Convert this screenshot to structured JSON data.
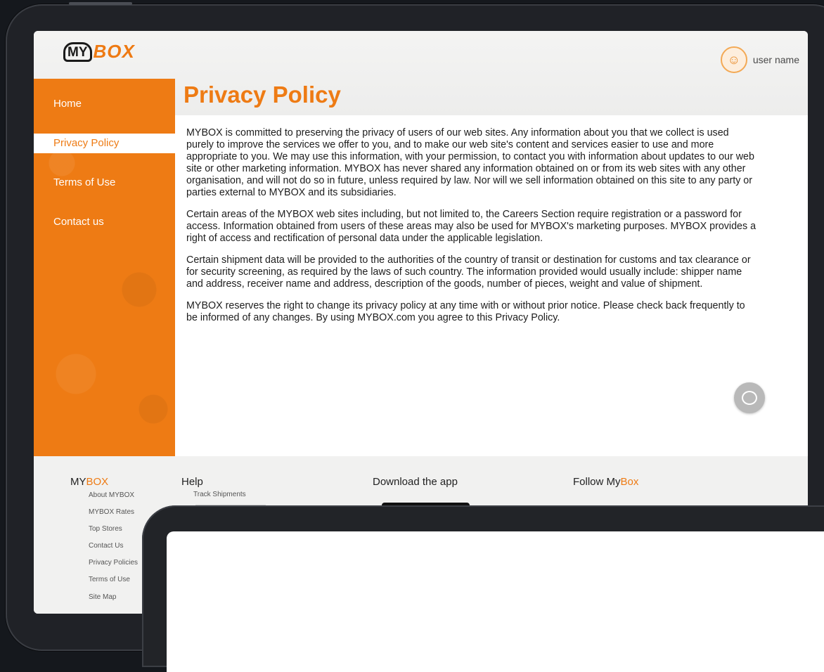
{
  "brand": {
    "logo_my": "MY",
    "logo_box": "BOX"
  },
  "user": {
    "name": "user name",
    "avatar_glyph": "☺"
  },
  "sidebar": {
    "items": [
      {
        "label": "Home",
        "active": false
      },
      {
        "label": "Privacy Policy",
        "active": true
      },
      {
        "label": "Terms of Use",
        "active": false
      },
      {
        "label": "Contact us",
        "active": false
      }
    ]
  },
  "page": {
    "title": "Privacy Policy",
    "paragraphs": [
      "MYBOX is committed to preserving the privacy of users of our web sites. Any information about you that we collect is used purely to improve the services we offer to you, and to make our web site's content and services easier to use and more appropriate to you. We may use this information, with your permission, to contact you with information about updates to our web site or other marketing information. MYBOX has never shared any information obtained on or from its web sites with any other organisation, and will not do so in future, unless required by law. Nor will we sell information obtained on this site to any party or parties external to MYBOX and its subsidiaries.",
      "Certain areas of the MYBOX web sites including, but not limited to, the Careers Section require registration or a password for access. Information obtained from users of these areas may also be used for MYBOX's marketing purposes. MYBOX provides a right of access and rectification of personal data under the applicable legislation.",
      "Certain shipment data will be provided to the authorities of the country of transit or destination for customs and tax clearance or for security screening, as required by the laws of such country. The information provided would usually include: shipper name and address, receiver name and address, description of the goods, number of pieces, weight and value of shipment.",
      "MYBOX reserves the right to change its privacy policy at any time with or without prior notice. Please check back frequently to be informed of any changes. By using MYBOX.com you agree to this Privacy Policy."
    ]
  },
  "footer": {
    "col1": {
      "title_a": "MY",
      "title_b": "BOX",
      "links": [
        "About MYBOX",
        "MYBOX Rates",
        "Top Stores",
        "Contact Us",
        "Privacy Policies",
        "Terms of Use",
        "Site Map"
      ]
    },
    "col2": {
      "title": "Help",
      "links": [
        "Track Shipments"
      ]
    },
    "col3": {
      "title": "Download the app"
    },
    "col4": {
      "title_a": "Follow My",
      "title_b": "Box"
    }
  },
  "colors": {
    "accent": "#ee7b14",
    "background": "#15181d"
  }
}
